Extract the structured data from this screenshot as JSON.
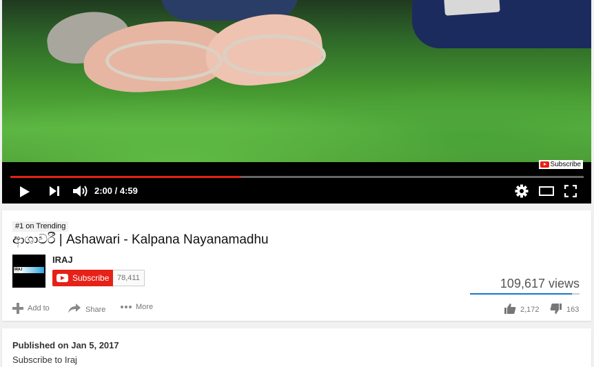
{
  "player": {
    "watermark_label": "Subscribe",
    "time_display": "2:00 / 4:59",
    "progress_fraction": 0.4013
  },
  "video": {
    "trending_badge": "#1 on Trending",
    "title": "ආශාවරී | Ashawari - Kalpana Nayanamadhu",
    "view_count": "109,617 views"
  },
  "channel": {
    "name": "IRAJ",
    "avatar_text": "IRAJ",
    "subscribe_label": "Subscribe",
    "subscriber_count": "78,411"
  },
  "actions": {
    "add_to": "Add to",
    "share": "Share",
    "more": "More",
    "likes": "2,172",
    "dislikes": "163",
    "like_fraction": 0.93
  },
  "description": {
    "published": "Published on Jan 5, 2017",
    "text": "Subscribe to Iraj"
  },
  "colors": {
    "accent_red": "#e62117",
    "like_blue": "#167ac6"
  }
}
